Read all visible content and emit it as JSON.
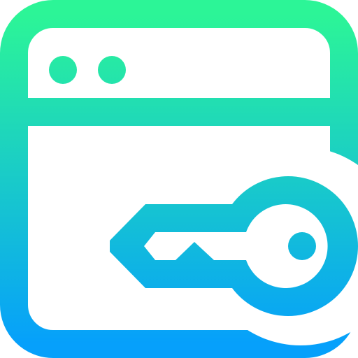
{
  "icon": {
    "name": "browser-key-icon",
    "parts": [
      "browser-window-icon",
      "key-icon"
    ],
    "gradient": {
      "top_color": "#2cf597",
      "bottom_color": "#06a0fb"
    },
    "background_color": "#ffffff"
  }
}
